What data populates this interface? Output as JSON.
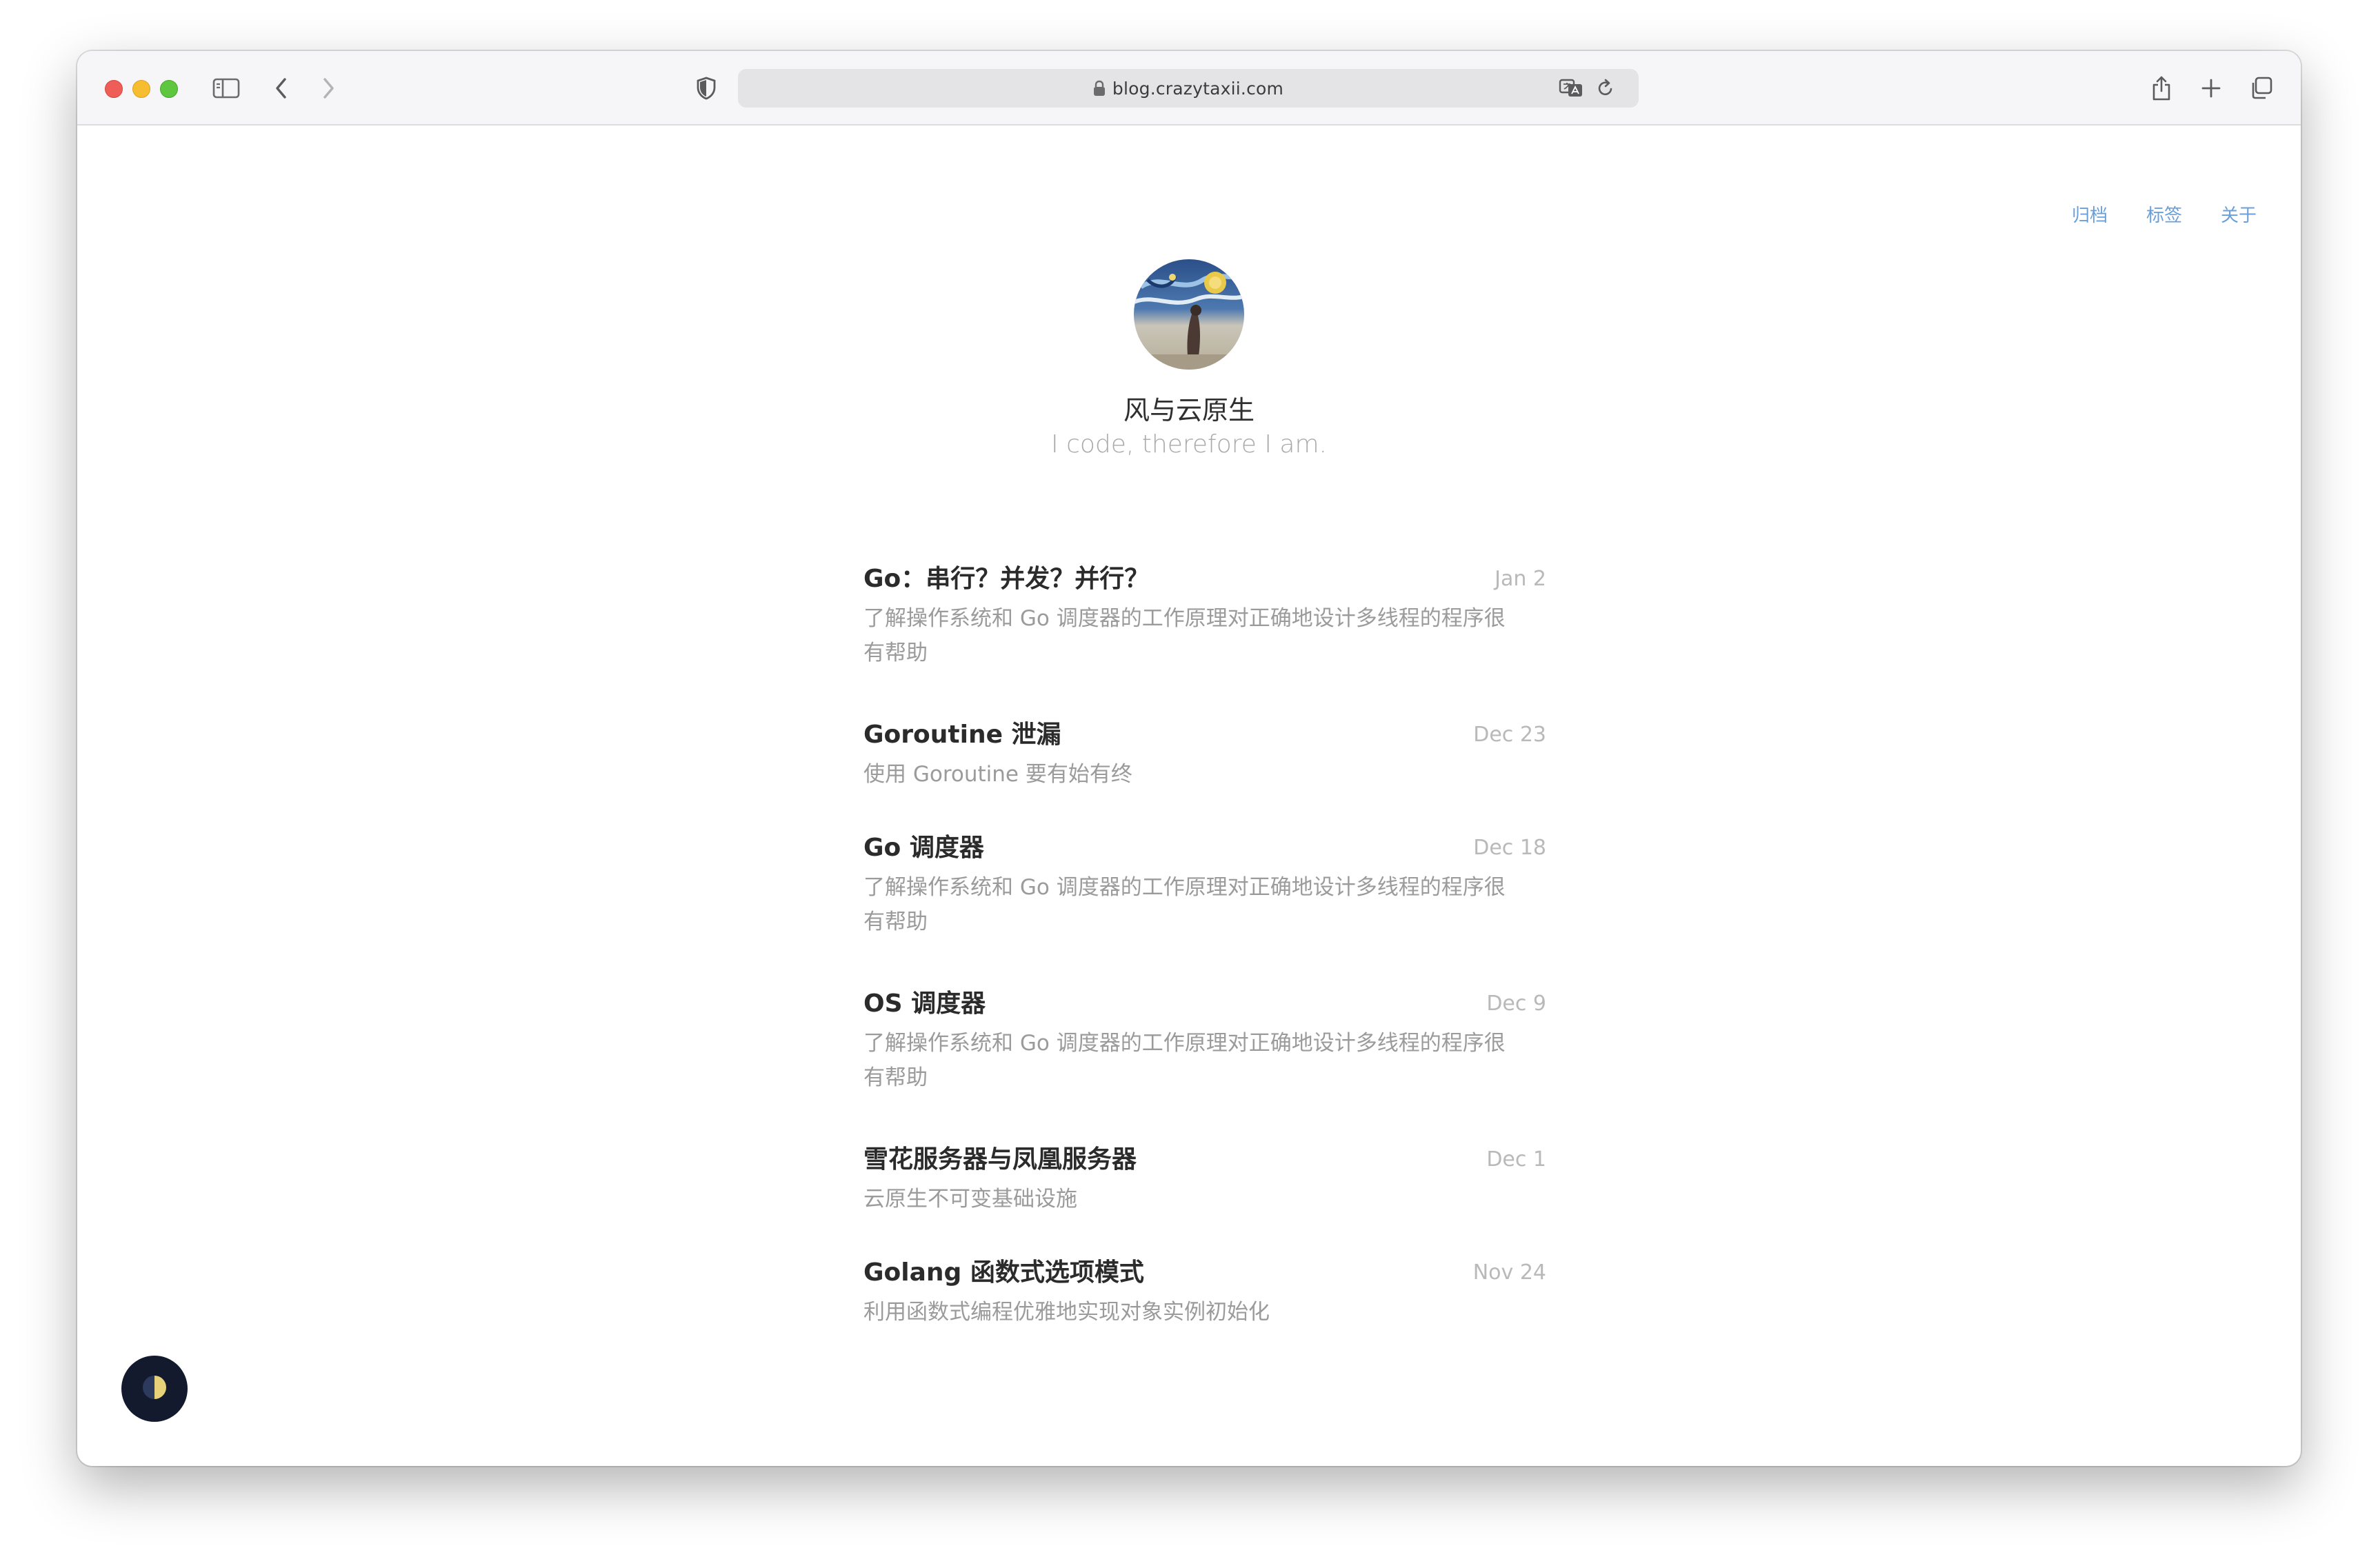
{
  "browser": {
    "url": "blog.crazytaxii.com",
    "icons": {
      "sidebar": "sidebar-icon",
      "back": "chevron-left-icon",
      "forward": "chevron-right-icon",
      "privacy": "shield-icon",
      "lock": "lock-icon",
      "translate": "translate-icon",
      "reload": "reload-icon",
      "share": "share-icon",
      "new_tab": "plus-icon",
      "tabs": "tabs-overview-icon"
    }
  },
  "nav": {
    "items": [
      {
        "label": "归档"
      },
      {
        "label": "标签"
      },
      {
        "label": "关于"
      }
    ]
  },
  "site": {
    "title": "风与云原生",
    "subtitle": "I code, therefore I am."
  },
  "posts": [
    {
      "title": "Go：串行？并发？并行？",
      "date": "Jan 2",
      "description": "了解操作系统和 Go 调度器的工作原理对正确地设计多线程的程序很有帮助"
    },
    {
      "title": "Goroutine 泄漏",
      "date": "Dec 23",
      "description": "使用 Goroutine 要有始有终"
    },
    {
      "title": "Go 调度器",
      "date": "Dec 18",
      "description": "了解操作系统和 Go 调度器的工作原理对正确地设计多线程的程序很有帮助"
    },
    {
      "title": "OS 调度器",
      "date": "Dec 9",
      "description": "了解操作系统和 Go 调度器的工作原理对正确地设计多线程的程序很有帮助"
    },
    {
      "title": "雪花服务器与凤凰服务器",
      "date": "Dec 1",
      "description": "云原生不可变基础设施"
    },
    {
      "title": "Golang 函数式选项模式",
      "date": "Nov 24",
      "description": "利用函数式编程优雅地实现对象实例初始化"
    }
  ],
  "theme_toggle": {
    "icon": "half-moon-icon"
  },
  "colors": {
    "link": "#6a9fd9",
    "title": "#2b2b2b",
    "muted": "#9b9b9b",
    "date": "#b9b9b9",
    "toggle_bg": "#131a2e"
  }
}
